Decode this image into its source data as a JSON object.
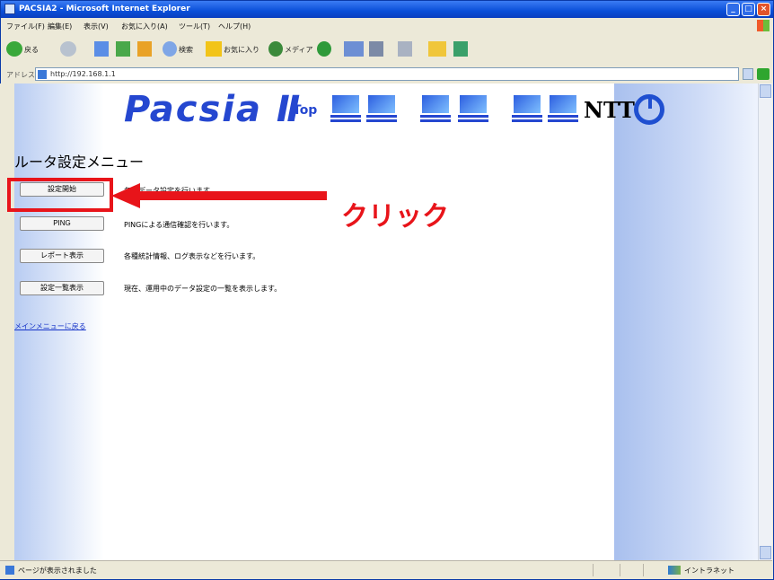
{
  "window": {
    "title": "PACSIA2 - Microsoft Internet Explorer"
  },
  "menubar": {
    "items": [
      "ファイル(F)",
      "編集(E)",
      "表示(V)",
      "お気に入り(A)",
      "ツール(T)",
      "ヘルプ(H)"
    ]
  },
  "toolbar": {
    "back_label": "戻る",
    "search_label": "検索",
    "favorites_label": "お気に入り",
    "media_label": "メディア"
  },
  "address": {
    "label": "アドレス(D)",
    "url": "http://192.168.1.1"
  },
  "header": {
    "logo_text": "Pacsia Ⅱ",
    "top_link": "Top",
    "brand": "NTT"
  },
  "main": {
    "heading": "ルータ設定メニュー",
    "menu": [
      {
        "button": "設定開始",
        "desc": "各種データ設定を行います。"
      },
      {
        "button": "PING",
        "desc": "PINGによる通信確認を行います。"
      },
      {
        "button": "レポート表示",
        "desc": "各種統計情報、ログ表示などを行います。"
      },
      {
        "button": "設定一覧表示",
        "desc": "現在、運用中のデータ設定の一覧を表示します。"
      }
    ],
    "back_link": "メインメニューに戻る"
  },
  "annotation": {
    "callout": "クリック",
    "color": "#e8141a"
  },
  "statusbar": {
    "text": "ページが表示されました",
    "zone": "イントラネット"
  },
  "colors": {
    "accent": "#2547d0",
    "highlight": "#e8141a"
  }
}
